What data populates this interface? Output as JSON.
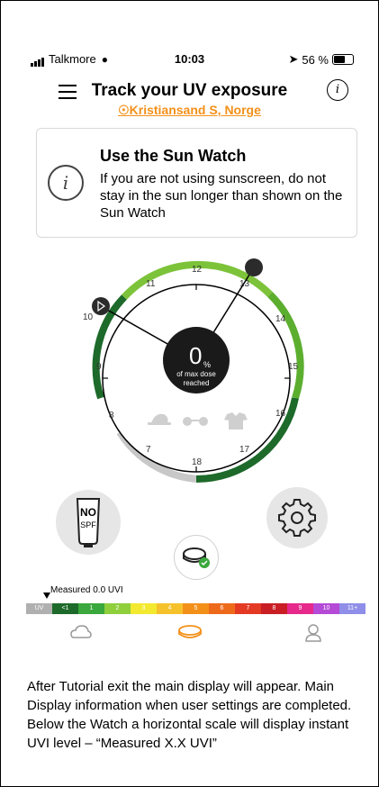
{
  "status": {
    "carrier": "Talkmore",
    "time": "10:03",
    "battery": "56 %"
  },
  "header": {
    "title": "Track your UV exposure",
    "location": "Kristiansand S, Norge",
    "info_icon": "i"
  },
  "card": {
    "icon": "i",
    "title": "Use the Sun Watch",
    "text": "If you are not using sunscreen, do not stay in the sun longer than shown on the Sun Watch"
  },
  "watch": {
    "percent": "0",
    "percent_sign": "%",
    "label_line1": "of max dose",
    "label_line2": "reached",
    "hours": [
      "12",
      "13",
      "14",
      "15",
      "16",
      "17",
      "18",
      "7",
      "8",
      "9",
      "10",
      "11"
    ]
  },
  "buttons": {
    "nospf_line1": "NO",
    "nospf_line2": "SPF"
  },
  "measured": "Measured 0.0 UVI",
  "scale": [
    {
      "label": "UV",
      "color": "#b0b0b0"
    },
    {
      "label": "<1",
      "color": "#1d6a2a"
    },
    {
      "label": "1",
      "color": "#3aa83c"
    },
    {
      "label": "2",
      "color": "#8fcf3c"
    },
    {
      "label": "3",
      "color": "#f2e930"
    },
    {
      "label": "4",
      "color": "#f5c22b"
    },
    {
      "label": "5",
      "color": "#f39019"
    },
    {
      "label": "6",
      "color": "#ee6a1b"
    },
    {
      "label": "7",
      "color": "#e43a24"
    },
    {
      "label": "8",
      "color": "#c81e24"
    },
    {
      "label": "9",
      "color": "#e6298a"
    },
    {
      "label": "10",
      "color": "#b44ad6"
    },
    {
      "label": "11+",
      "color": "#8f8ee8"
    }
  ],
  "caption": "After Tutorial exit the main display will appear. Main Display information when user settings are completed. Below the Watch a horizontal scale will display instant UVI level – “Measured X.X UVI”",
  "colors": {
    "accent": "#f39019",
    "green_dark": "#1d6a2a",
    "green_light": "#6fbf2a"
  }
}
